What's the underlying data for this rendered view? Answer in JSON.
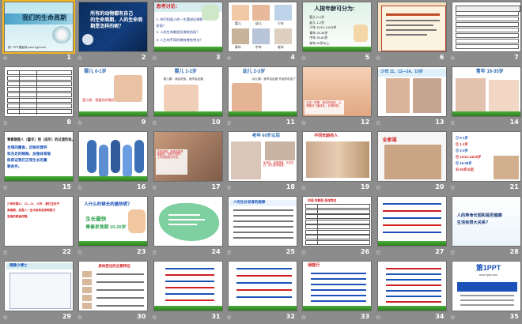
{
  "star_glyph": "☆",
  "slides": [
    {
      "num": "1",
      "title": "我们的生命周期",
      "footer": "第一PPT模板网 www.1ppt.com"
    },
    {
      "num": "2",
      "lines": [
        "所有的动物都有自己",
        "的生命周期，人的生命周",
        "期是怎样的呢？"
      ]
    },
    {
      "num": "3",
      "title": "思考讨论：",
      "lines": [
        "1. 你们知道人的一生要经历哪些",
        "阶段？",
        "2. 人的生命都经历哪些阶段？",
        "3. 人生的不同时期有哪些特点？"
      ]
    },
    {
      "num": "4",
      "labels": [
        "婴儿",
        "幼儿",
        "少年",
        "青年",
        "中年",
        "老年"
      ]
    },
    {
      "num": "5",
      "title": "人按年龄可分为:",
      "lines": [
        "婴儿 0-1岁",
        "幼儿 1-2岁",
        "少年 11/12-14/15岁",
        "青年 16-35岁",
        "中年 35-60岁",
        "老年 60岁以上"
      ]
    },
    {
      "num": "6"
    },
    {
      "num": "7"
    },
    {
      "num": "8"
    },
    {
      "num": "9",
      "title": "婴儿 0-1岁",
      "caption": "婴儿期：我要妈妈喂奶"
    },
    {
      "num": "10",
      "title": "婴儿 1-2岁",
      "caption": "婴儿期：我会吃饭，我学会走路"
    },
    {
      "num": "11",
      "title": "幼儿 2-3岁",
      "caption": "幼儿期：我学会走路 开始学说话了"
    },
    {
      "num": "12",
      "caption": "在这一时期，我们的身体、心理都在飞速成长，长得很快。"
    },
    {
      "num": "13",
      "title": "少年 11、12—14、15岁"
    },
    {
      "num": "14",
      "title": "青年 16-35岁"
    },
    {
      "num": "15",
      "lines": [
        "青春期是人（童年）到（成年）的过渡阶段。",
        "合理的膳食，足够的营养",
        "和充足的睡眠、加强体育锻",
        "炼保证我们正常生长的重",
        "要条件。"
      ]
    },
    {
      "num": "16"
    },
    {
      "num": "17",
      "caption": "中年时期，身体机能开始减退，但精力较好，工作经验较为丰富。"
    },
    {
      "num": "18",
      "title": "老年 60岁以后",
      "caption": "年老时，皮肤褶皱、头发变白、视力逐渐衰退。"
    },
    {
      "num": "19",
      "title": "不同年龄的人"
    },
    {
      "num": "20",
      "title": "全家福"
    },
    {
      "num": "21",
      "lines": [
        "① 0-1岁",
        "② 1-2岁",
        "③ 2-3岁",
        "④ 11/12-14/15岁",
        "⑤ 16-35岁",
        "⑥ 60岁以后"
      ]
    },
    {
      "num": "22",
      "lines": [
        "少年时期11、12—14、15岁，我们正处于",
        "青春期，这是人一生中身体发育和智力",
        "发展的黄金时期。"
      ]
    },
    {
      "num": "23",
      "title": "人什么时候长的最快呢？",
      "lines": [
        "生长最快",
        "青春发育期 10-20岁"
      ]
    },
    {
      "num": "24"
    },
    {
      "num": "25",
      "title": "人的生长发育的规律"
    },
    {
      "num": "26",
      "title": "阶段 年龄段 身体特点"
    },
    {
      "num": "27"
    },
    {
      "num": "28",
      "lines": [
        "人的寿命长短和是否健康",
        "生活有很大关系?"
      ]
    },
    {
      "num": "29",
      "title": "健康小博士"
    },
    {
      "num": "30",
      "title": "身体变化的主要特征"
    },
    {
      "num": "31"
    },
    {
      "num": "32"
    },
    {
      "num": "33",
      "title": "我能行"
    },
    {
      "num": "34"
    },
    {
      "num": "35",
      "title": "第1PPT",
      "subtitle": "www.1ppt.com"
    }
  ]
}
